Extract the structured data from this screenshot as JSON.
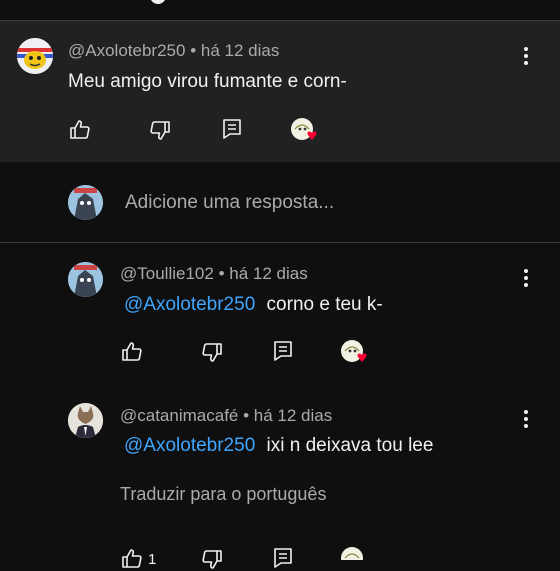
{
  "parent_comment": {
    "author": "@Axolotebr250",
    "separator": "•",
    "time": "há 12 dias",
    "text": "Meu amigo virou fumante e corn-"
  },
  "reply_box": {
    "placeholder": "Adicione uma resposta..."
  },
  "replies": [
    {
      "author": "@Toullie102",
      "separator": "•",
      "time": "há 12 dias",
      "mention": "@Axolotebr250",
      "text": "corno e teu k-"
    },
    {
      "author": "@catanimacafé",
      "separator": "•",
      "time": "há 12 dias",
      "mention": "@Axolotebr250",
      "text": "ixi n deixava tou lee",
      "translate_label": "Traduzir para o português",
      "like_count": "1"
    }
  ],
  "icons": [
    "like-icon",
    "dislike-icon",
    "reply-icon",
    "creator-heart-icon",
    "more-vert-icon"
  ],
  "colors": {
    "background": "#0f0f0f",
    "highlight": "#212121",
    "link": "#3ea6ff",
    "meta": "#aaaaaa",
    "heart": "#ff0033"
  }
}
